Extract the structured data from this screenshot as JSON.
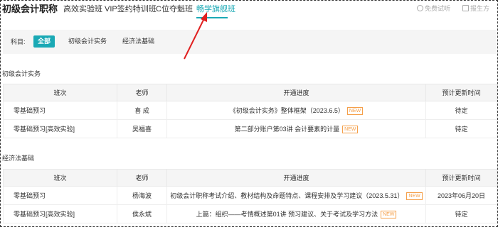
{
  "header": {
    "brand": "初级会计职称",
    "tabs": [
      {
        "label": "高效实验班"
      },
      {
        "label": "VIP签约特训班"
      },
      {
        "label": "C位夺魁班"
      },
      {
        "label": "畅学旗舰班"
      }
    ],
    "active_tab": "畅学旗舰班",
    "right_links": [
      {
        "label": "免费试听",
        "icon": "play-icon"
      },
      {
        "label": "报生方",
        "icon": "edit-icon"
      }
    ]
  },
  "filter": {
    "label": "科目:",
    "chips": [
      {
        "label": "全部"
      },
      {
        "label": "初级会计实务"
      },
      {
        "label": "经济法基础"
      }
    ],
    "selected": "全部"
  },
  "columns": [
    "班次",
    "老师",
    "开通进度",
    "预计更新时间"
  ],
  "sections": [
    {
      "title": "初级会计实务",
      "rows": [
        {
          "class": "零基础预习",
          "teacher": "喜 成",
          "progress": "《初级会计实务》整体框架（2023.6.5）",
          "new": "NEW",
          "update": "待定"
        },
        {
          "class": "零基础预习[高效实验]",
          "teacher": "吴福喜",
          "progress": "第二部分账户第03讲  会计要素的计量",
          "new": "NEW",
          "update": "待定"
        }
      ]
    },
    {
      "title": "经济法基础",
      "rows": [
        {
          "class": "零基础预习",
          "teacher": "杨海波",
          "progress": "初级会计职称考试介绍、教材结构及命题特点、课程安排及学习建议（2023.5.31）",
          "new": "NEW",
          "update": "2023年06月20日"
        },
        {
          "class": "零基础预习[高效实验]",
          "teacher": "侯永斌",
          "progress": "上篇：组织——考情概述第01讲  预习建议、关于考试及学习方法",
          "new": "NEW",
          "update": "待定"
        }
      ]
    }
  ],
  "colors": {
    "accent": "#1aa9b5",
    "new_tag": "#f5a04a",
    "arrow": "#e02020"
  }
}
